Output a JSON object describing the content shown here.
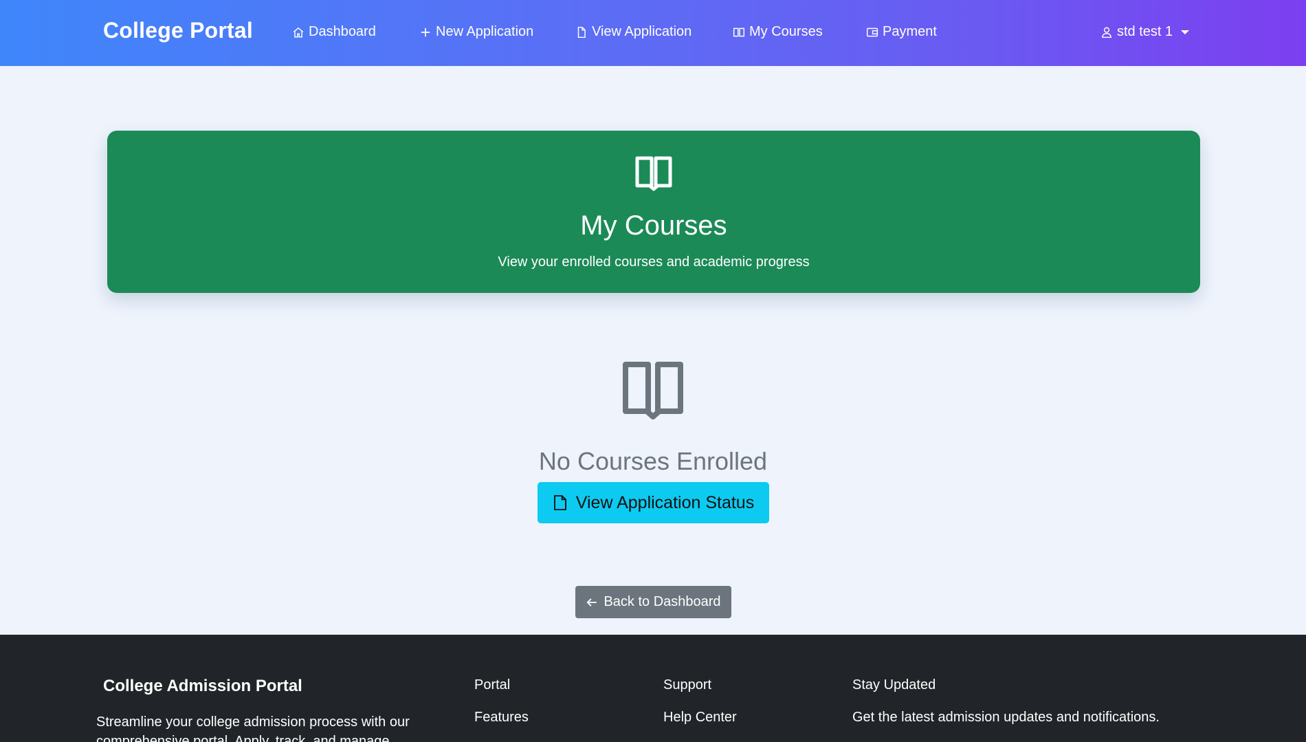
{
  "navbar": {
    "brand": "College Portal",
    "items": [
      {
        "label": "Dashboard",
        "icon": "home-icon"
      },
      {
        "label": "New Application",
        "icon": "plus-icon"
      },
      {
        "label": "View Application",
        "icon": "file-icon"
      },
      {
        "label": "My Courses",
        "icon": "book-icon"
      },
      {
        "label": "Payment",
        "icon": "wallet-icon"
      }
    ],
    "user": {
      "label": "std test 1",
      "icon": "user-icon"
    }
  },
  "hero": {
    "title": "My Courses",
    "subtitle": "View your enrolled courses and academic progress",
    "icon": "book-icon",
    "background": "#1b8a57"
  },
  "empty_state": {
    "title": "No Courses Enrolled",
    "icon": "book-icon",
    "action_label": "View Application Status",
    "action_icon": "file-icon",
    "action_color": "#0dcaf0"
  },
  "back_button": {
    "label": "Back to Dashboard",
    "icon": "arrow-left-icon"
  },
  "footer": {
    "brand": "College Admission Portal",
    "description": "Streamline your college admission process with our comprehensive portal. Apply, track, and manage",
    "columns": [
      {
        "heading": "Portal",
        "links": [
          "Features"
        ]
      },
      {
        "heading": "Support",
        "links": [
          "Help Center"
        ]
      },
      {
        "heading": "Stay Updated",
        "text": "Get the latest admission updates and notifications."
      }
    ]
  }
}
